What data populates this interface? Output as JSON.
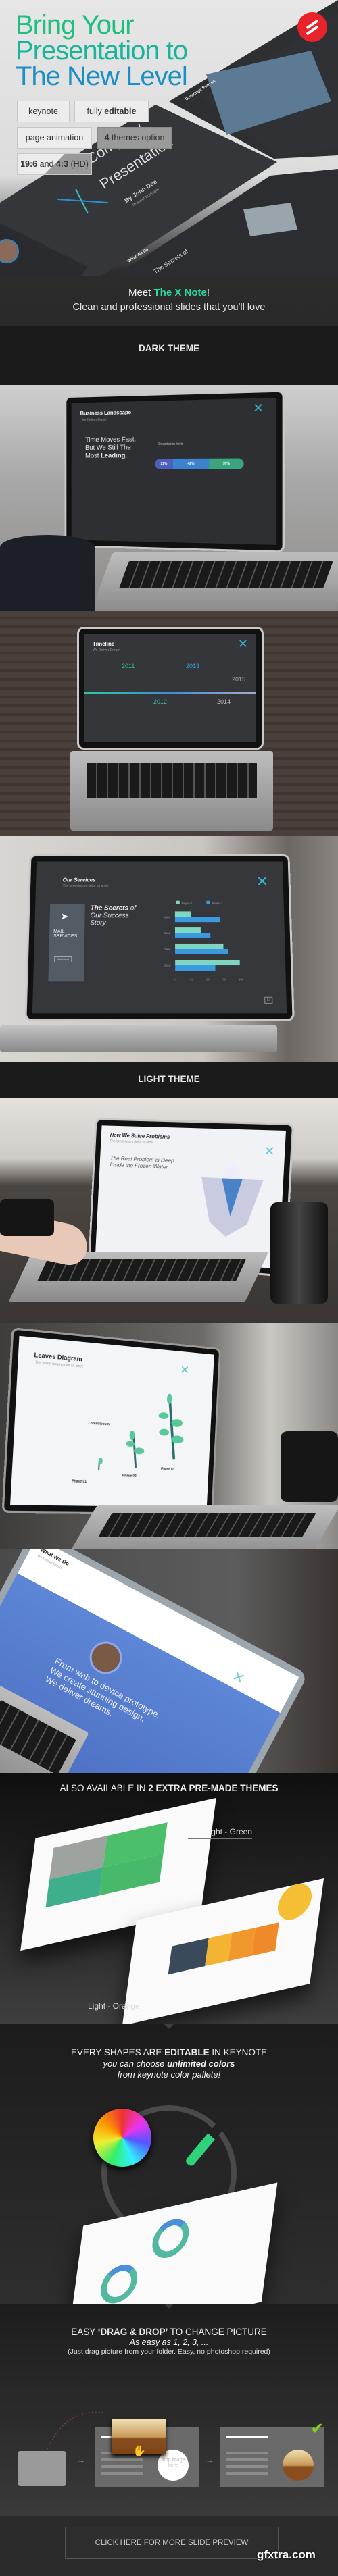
{
  "hero": {
    "title_lines": [
      "Bring Your",
      "Presentation to",
      "The New Level"
    ],
    "badges": [
      {
        "normal": "keynote",
        "bold": ""
      },
      {
        "normal": "fully ",
        "bold": "editable"
      },
      {
        "normal": "page animation",
        "bold": ""
      },
      {
        "normal": " themes option",
        "bold": "4"
      },
      {
        "bold": "19:6",
        "normal": " and ",
        "bold2": "4:3",
        "normal2": " (HD)"
      }
    ],
    "slide_preview": {
      "title1": "Company",
      "title2": "Presentation",
      "author": "By John Doe",
      "role": "Product Manager",
      "greeting": "Greetings from us",
      "what": "What We Do",
      "secrets": "The Secrets of"
    },
    "tagline": {
      "pre": "Meet ",
      "brand": "The X Note",
      "post": "!"
    },
    "subtitle": "Clean and professional slides that you'll love",
    "colors": {
      "green": "#1fbf7e",
      "blue": "#1b8fc6",
      "logo": "#e8232a"
    }
  },
  "dark_theme_label": "DARK THEME",
  "light_theme_label": "LIGHT THEME",
  "slides": {
    "business": {
      "title": "Business Landscape",
      "subtitle": "We Deliver Dream",
      "headline1": "Time Moves Fast.",
      "headline2": "But We Still The",
      "headline3": "Most ",
      "headline_bold": "Leading.",
      "bar_values": [
        "21%",
        "42%",
        "39%"
      ],
      "desc": "Description here"
    },
    "timeline": {
      "title": "Timeline",
      "subtitle": "We Deliver Dream",
      "years": [
        "2011",
        "2012",
        "2013",
        "2014",
        "2015"
      ]
    },
    "services": {
      "title": "Our Services",
      "subtitle": "The lorem ipsum dolor sit amet",
      "card": "MAIL SERVICES",
      "card_button": "Welcome!",
      "headline_bold": "The Secrets",
      "headline_rest": " of Our Success Story",
      "legend": [
        "Region 1",
        "Region 2"
      ],
      "rows": [
        "2007",
        "2008",
        "2009",
        "2010"
      ],
      "axis": [
        "0",
        "25",
        "50",
        "75",
        "100"
      ],
      "page": "17",
      "chart_region1": [
        25,
        40,
        75,
        100
      ],
      "chart_region2": [
        70,
        55,
        82,
        62
      ]
    },
    "problems": {
      "title": "How We Solve Problems",
      "subtitle": "The lorem ipsum dolor sit amet",
      "headline": "The Real Problem is Deep Inside the Frozen Water."
    },
    "leaves": {
      "title": "Leaves Diagram",
      "subtitle": "The lorem ipsum dolor sit amet",
      "phases": [
        "Phase 01",
        "Phase 02",
        "Phase 03"
      ],
      "annotation": "Lorem Ipsum"
    },
    "whatwedo": {
      "title": "What We Do",
      "subtitle": "We Deliver Dream",
      "line1_pre": "From ",
      "line1_bold": "web",
      "line1_post": " to device prototype.",
      "line2_pre": "We create ",
      "line2_bold": "stunning",
      "line2_post": " design.",
      "line3_pre": "We deliver ",
      "line3_bold": "dreams."
    }
  },
  "extras": {
    "heading_normal": "ALSO AVAILABLE IN ",
    "heading_bold": "2 EXTRA PRE-MADE THEMES",
    "label_green": "Light - Green",
    "label_orange": "Light -  Orange"
  },
  "editable": {
    "line1_pre": "EVERY SHAPES ARE ",
    "line1_bold": "EDITABLE",
    "line1_post": " IN KEYNOTE",
    "line2_pre": "you can choose ",
    "line2_bold": "unlimited colors",
    "line3": "from keynote color pallete!"
  },
  "drag": {
    "line1_pre": "EASY ",
    "line1_bold": "‘DRAG & DROP’",
    "line1_post": " TO CHANGE PICTURE",
    "line2": "As easy as 1, 2, 3, ...",
    "line3": "(Just drag picture from your folder. Easy, no photoshop required)",
    "drop_text": "drop image here",
    "steps": [
      "1",
      "2",
      "3"
    ]
  },
  "cta": {
    "label": "CLICK HERE FOR MORE SLIDE PREVIEW"
  },
  "watermark": "gfxtra.com"
}
